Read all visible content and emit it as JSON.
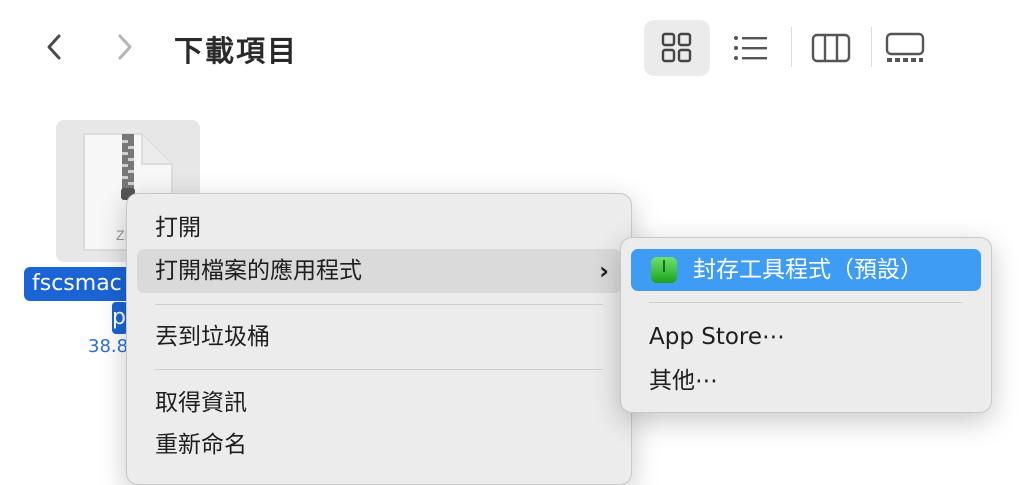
{
  "toolbar": {
    "title": "下載項目"
  },
  "file": {
    "name_line1": "fscsmac",
    "name_line2": "p",
    "size": "38.8"
  },
  "context_menu": {
    "items": [
      {
        "label": "打開"
      },
      {
        "label": "打開檔案的應用程式",
        "has_submenu": true
      },
      {
        "label": "丟到垃圾桶"
      },
      {
        "label": "取得資訊"
      },
      {
        "label": "重新命名"
      }
    ],
    "submenu_chevron": "›"
  },
  "submenu": {
    "items": [
      {
        "label": "封存工具程式（預設）",
        "icon": "archive-utility-icon",
        "selected": true
      },
      {
        "label": "App Store⋯"
      },
      {
        "label": "其他⋯"
      }
    ]
  },
  "colors": {
    "selection_blue": "#1a64d6",
    "submenu_highlight": "#3f9cf5",
    "menu_bg": "#ececec"
  }
}
